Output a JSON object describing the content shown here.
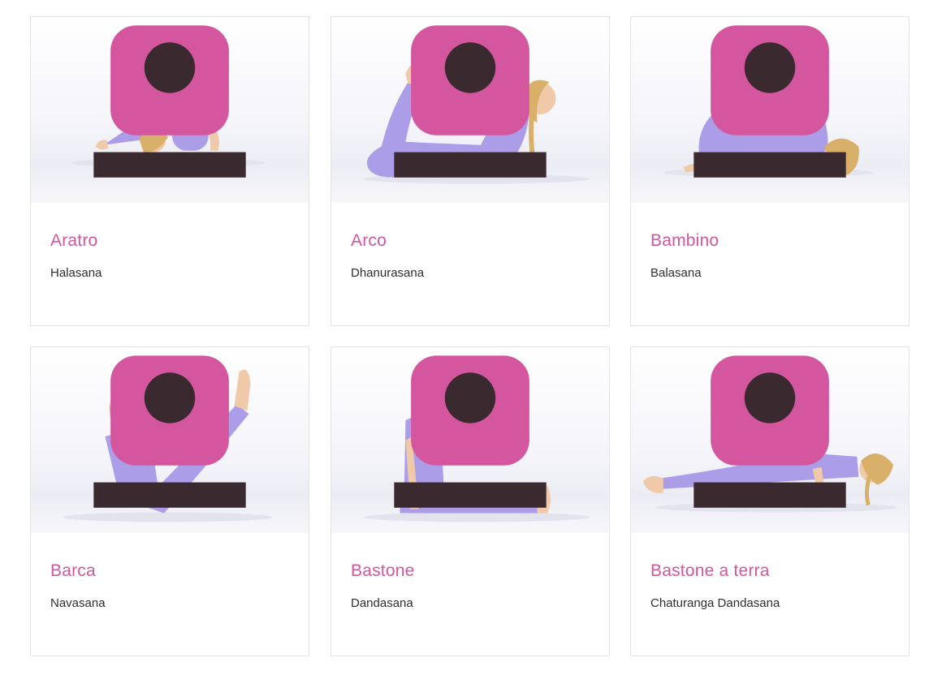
{
  "poses": [
    {
      "name": "Aratro",
      "sanskrit": "Halasana"
    },
    {
      "name": "Arco",
      "sanskrit": "Dhanurasana"
    },
    {
      "name": "Bambino",
      "sanskrit": "Balasana"
    },
    {
      "name": "Barca",
      "sanskrit": "Navasana"
    },
    {
      "name": "Bastone",
      "sanskrit": "Dandasana"
    },
    {
      "name": "Bastone a terra",
      "sanskrit": "Chaturanga Dandasana"
    }
  ],
  "colors": {
    "title": "#d4569e",
    "text": "#2d2d2d",
    "outfit": "#ab9de8",
    "hair": "#d9b06a",
    "skin": "#f0c9a8"
  }
}
